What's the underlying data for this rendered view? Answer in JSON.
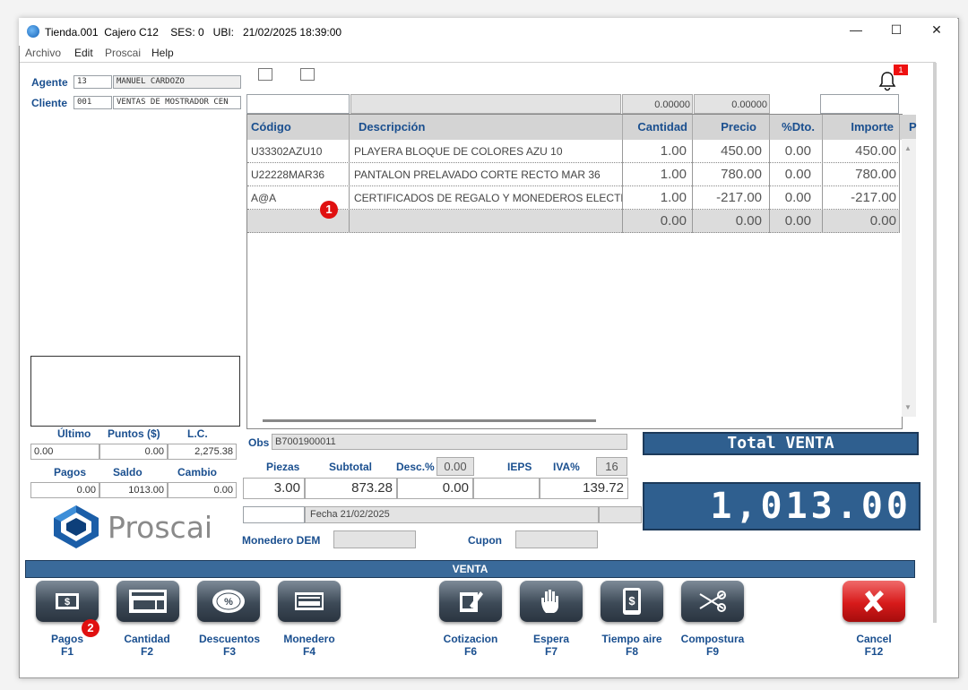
{
  "window": {
    "title": "Tienda.001  Cajero C12    SES: 0   UBI:   21/02/2025 18:39:00",
    "min": "—",
    "max": "☐",
    "close": "✕"
  },
  "menu": [
    "Archivo",
    "Edit",
    "Proscai",
    "Help"
  ],
  "agente": {
    "label": "Agente",
    "code": "13",
    "name": "MANUEL CARDOZO"
  },
  "cliente": {
    "label": "Cliente",
    "code": "001",
    "name": "VENTAS DE MOSTRADOR CEN"
  },
  "notifications": {
    "count": "1"
  },
  "top_values": {
    "v1": "0.00000",
    "v2": "0.00000"
  },
  "grid": {
    "headers": [
      "Código",
      "Descripción",
      "Cantidad",
      "Precio",
      "%Dto.",
      "Importe",
      "P"
    ],
    "rows": [
      {
        "codigo": "U33302AZU10",
        "descripcion": "PLAYERA BLOQUE DE COLORES AZU 10",
        "cantidad": "1.00",
        "precio": "450.00",
        "dto": "0.00",
        "importe": "450.00"
      },
      {
        "codigo": "U22228MAR36",
        "descripcion": "PANTALON PRELAVADO CORTE RECTO MAR 36",
        "cantidad": "1.00",
        "precio": "780.00",
        "dto": "0.00",
        "importe": "780.00"
      },
      {
        "codigo": "A@A",
        "descripcion": "CERTIFICADOS DE REGALO Y MONEDEROS ELECTR",
        "cantidad": "1.00",
        "precio": "-217.00",
        "dto": "0.00",
        "importe": "-217.00"
      },
      {
        "codigo": "",
        "descripcion": "",
        "cantidad": "0.00",
        "precio": "0.00",
        "dto": "0.00",
        "importe": "0.00"
      }
    ]
  },
  "markers": {
    "m1": "1",
    "m2": "2"
  },
  "left_stats": {
    "ultimo_label": "Último",
    "puntos_label": "Puntos ($)",
    "lc_label": "L.C.",
    "ultimo": "0.00",
    "puntos": "0.00",
    "lc": "2,275.38",
    "pagos_label": "Pagos",
    "saldo_label": "Saldo",
    "cambio_label": "Cambio",
    "pagos": "0.00",
    "saldo": "1013.00",
    "cambio": "0.00"
  },
  "logo": {
    "text": "Proscai"
  },
  "obs": {
    "label": "Obs",
    "value": "B7001900011"
  },
  "summary": {
    "piezas_label": "Piezas",
    "subtotal_label": "Subtotal",
    "desc_label": "Desc.%",
    "desc_pct": "0.00",
    "ieps_label": "IEPS",
    "iva_label": "IVA%",
    "iva_pct": "16",
    "piezas": "3.00",
    "subtotal": "873.28",
    "descuento": "0.00",
    "ieps": "",
    "iva": "139.72"
  },
  "fecha": "Fecha 21/02/2025",
  "monedero": {
    "label": "Monedero DEM",
    "value": ""
  },
  "cupon": {
    "label": "Cupon",
    "value": ""
  },
  "total": {
    "label": "Total VENTA",
    "amount": "1,013.00"
  },
  "section_title": "VENTA",
  "fkeys": [
    {
      "label": "Pagos",
      "key": "F1"
    },
    {
      "label": "Cantidad",
      "key": "F2"
    },
    {
      "label": "Descuentos",
      "key": "F3"
    },
    {
      "label": "Monedero",
      "key": "F4"
    },
    {
      "label": "Cotizacion",
      "key": "F6"
    },
    {
      "label": "Espera",
      "key": "F7"
    },
    {
      "label": "Tiempo aire",
      "key": "F8"
    },
    {
      "label": "Compostura",
      "key": "F9"
    },
    {
      "label": "Cancel",
      "key": "F12"
    }
  ],
  "colors": {
    "accent": "#1a4f8f",
    "total_bg": "#2f5f8f",
    "cancel": "#d71a1a"
  }
}
